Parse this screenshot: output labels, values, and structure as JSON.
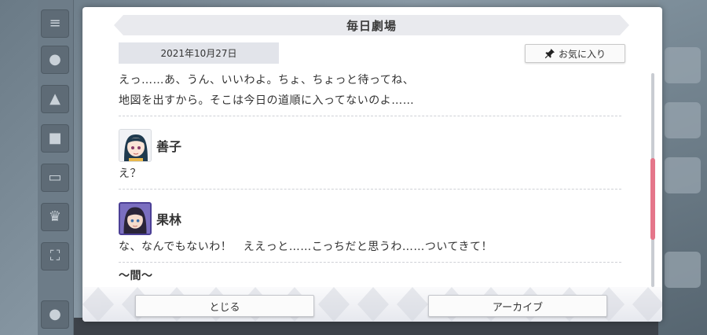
{
  "modal": {
    "title": "毎日劇場",
    "date": "2021年10月27日",
    "favorite_label": "お気に入り"
  },
  "story": {
    "intro_lines": [
      "えっ……あ、うん、いいわよ。ちょ、ちょっと待ってね、",
      "地図を出すから。そこは今日の道順に入ってないのよ……"
    ],
    "blocks": [
      {
        "speaker": "善子",
        "text": "え？"
      },
      {
        "speaker": "果林",
        "text": "な、なんでもないわ！　ええっと……こっちだと思うわ……ついてきて！"
      }
    ],
    "ending": "〜間〜"
  },
  "footer": {
    "close_label": "とじる",
    "archive_label": "アーカイブ"
  },
  "colors": {
    "scroll_thumb": "#e5768a",
    "karin_avatar_bg": "#6f63b4"
  },
  "icons": {
    "favorite": "pin-icon"
  }
}
